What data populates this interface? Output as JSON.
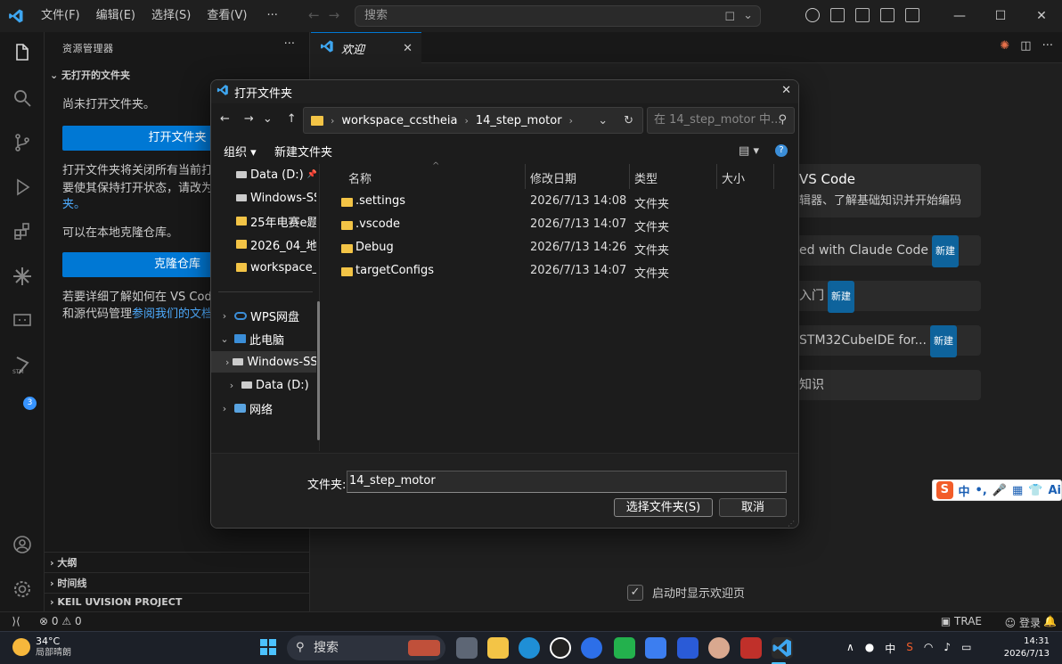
{
  "menu": {
    "file": "文件(F)",
    "edit": "编辑(E)",
    "selection": "选择(S)",
    "view": "查看(V)",
    "more": "···"
  },
  "search": {
    "placeholder": "搜索"
  },
  "sidebar": {
    "title": "资源管理器",
    "section": "无打开的文件夹",
    "no_folder": "尚未打开文件夹。",
    "open_folder_btn": "打开文件夹",
    "info_1": "打开文件夹将关闭所有当前打",
    "info_2": "要使其保持打开状态，请改为",
    "info_3": "夹。",
    "clone_text": "可以在本地克隆仓库。",
    "clone_btn": "克隆仓库",
    "learn_1": "若要详细了解如何在 VS Cod",
    "learn_2a": "和源代码管理",
    "learn_2b": "参阅我们的文档",
    "outline": "大纲",
    "timeline": "时间线",
    "keil": "KEIL UVISION PROJECT"
  },
  "activity": {
    "stm_badge": "3",
    "stm_label": "STM"
  },
  "tab": {
    "label": "欢迎"
  },
  "welcome": {
    "card1_title": "VS Code",
    "card1_sub": "辑器、了解基础知识并开始编码",
    "card2": "ed with Claude Code",
    "card3": "入门",
    "card4": "STM32CubeIDE for...",
    "card5": "知识",
    "new_badge": "新建",
    "show_on_startup": "启动时显示欢迎页"
  },
  "dialog": {
    "title": "打开文件夹",
    "path": [
      "workspace_ccstheia",
      "14_step_motor"
    ],
    "search_placeholder": "在 14_step_motor 中...",
    "organize": "组织 ▾",
    "new_folder": "新建文件夹",
    "nav_items": [
      {
        "label": "Data (D:)"
      },
      {
        "label": "Windows-SSD"
      },
      {
        "label": "25年电赛e题"
      },
      {
        "label": "2026_04_地铁"
      },
      {
        "label": "workspace_ccstheia"
      },
      {
        "label": "WPS网盘"
      },
      {
        "label": "此电脑"
      },
      {
        "label": "Windows-SSD"
      },
      {
        "label": "Data (D:)"
      },
      {
        "label": "网络"
      }
    ],
    "columns": {
      "name": "名称",
      "date": "修改日期",
      "type": "类型",
      "size": "大小"
    },
    "files": [
      {
        "name": ".settings",
        "date": "2026/7/13 14:08",
        "type": "文件夹"
      },
      {
        "name": ".vscode",
        "date": "2026/7/13 14:07",
        "type": "文件夹"
      },
      {
        "name": "Debug",
        "date": "2026/7/13 14:26",
        "type": "文件夹"
      },
      {
        "name": "targetConfigs",
        "date": "2026/7/13 14:07",
        "type": "文件夹"
      }
    ],
    "folder_label": "文件夹:",
    "folder_value": "14_step_motor",
    "select_btn": "选择文件夹(S)",
    "cancel_btn": "取消"
  },
  "statusbar": {
    "errors": "0",
    "warnings": "0",
    "trae": "TRAE",
    "login": "登录"
  },
  "taskbar": {
    "temp": "34°C",
    "weather": "局部晴朗",
    "search": "搜索",
    "ime_mode": "中",
    "time": "14:31",
    "date": "2026/7/13"
  },
  "ime": {
    "cn": "中",
    "ai": "Ai"
  },
  "colors": {
    "accent": "#0078d4",
    "folder": "#f3c446",
    "link": "#4daafc"
  }
}
